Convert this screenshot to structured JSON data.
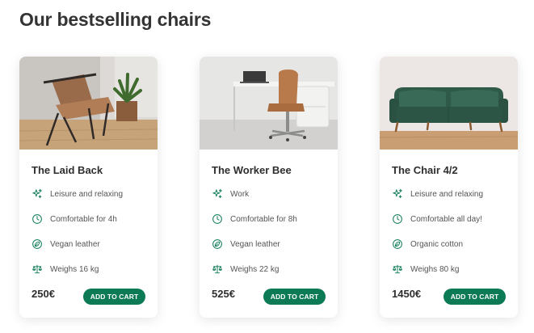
{
  "page": {
    "heading": "Our bestselling chairs"
  },
  "colors": {
    "accent": "#0b7a55",
    "heading": "#343434",
    "text": "#555555"
  },
  "products": [
    {
      "name": "The Laid Back",
      "image": "brown leather lounge chair with plant",
      "features": [
        {
          "icon": "sparkles-icon",
          "text": "Leisure and relaxing"
        },
        {
          "icon": "clock-icon",
          "text": "Comfortable for 4h"
        },
        {
          "icon": "leaf-badge-icon",
          "text": "Vegan leather"
        },
        {
          "icon": "scale-icon",
          "text": "Weighs 16 kg"
        }
      ],
      "price": "250€",
      "button": "ADD TO CART"
    },
    {
      "name": "The Worker Bee",
      "image": "brown office chair at white desk",
      "features": [
        {
          "icon": "sparkles-icon",
          "text": "Work"
        },
        {
          "icon": "clock-icon",
          "text": "Comfortable for 8h"
        },
        {
          "icon": "leaf-badge-icon",
          "text": "Vegan leather"
        },
        {
          "icon": "scale-icon",
          "text": "Weighs 22 kg"
        }
      ],
      "price": "525€",
      "button": "ADD TO CART"
    },
    {
      "name": "The Chair 4/2",
      "image": "dark green velvet sofa",
      "features": [
        {
          "icon": "sparkles-icon",
          "text": "Leisure and relaxing"
        },
        {
          "icon": "clock-icon",
          "text": "Comfortable all day!"
        },
        {
          "icon": "leaf-badge-icon",
          "text": "Organic cotton"
        },
        {
          "icon": "scale-icon",
          "text": "Weighs 80 kg"
        }
      ],
      "price": "1450€",
      "button": "ADD TO CART"
    }
  ]
}
